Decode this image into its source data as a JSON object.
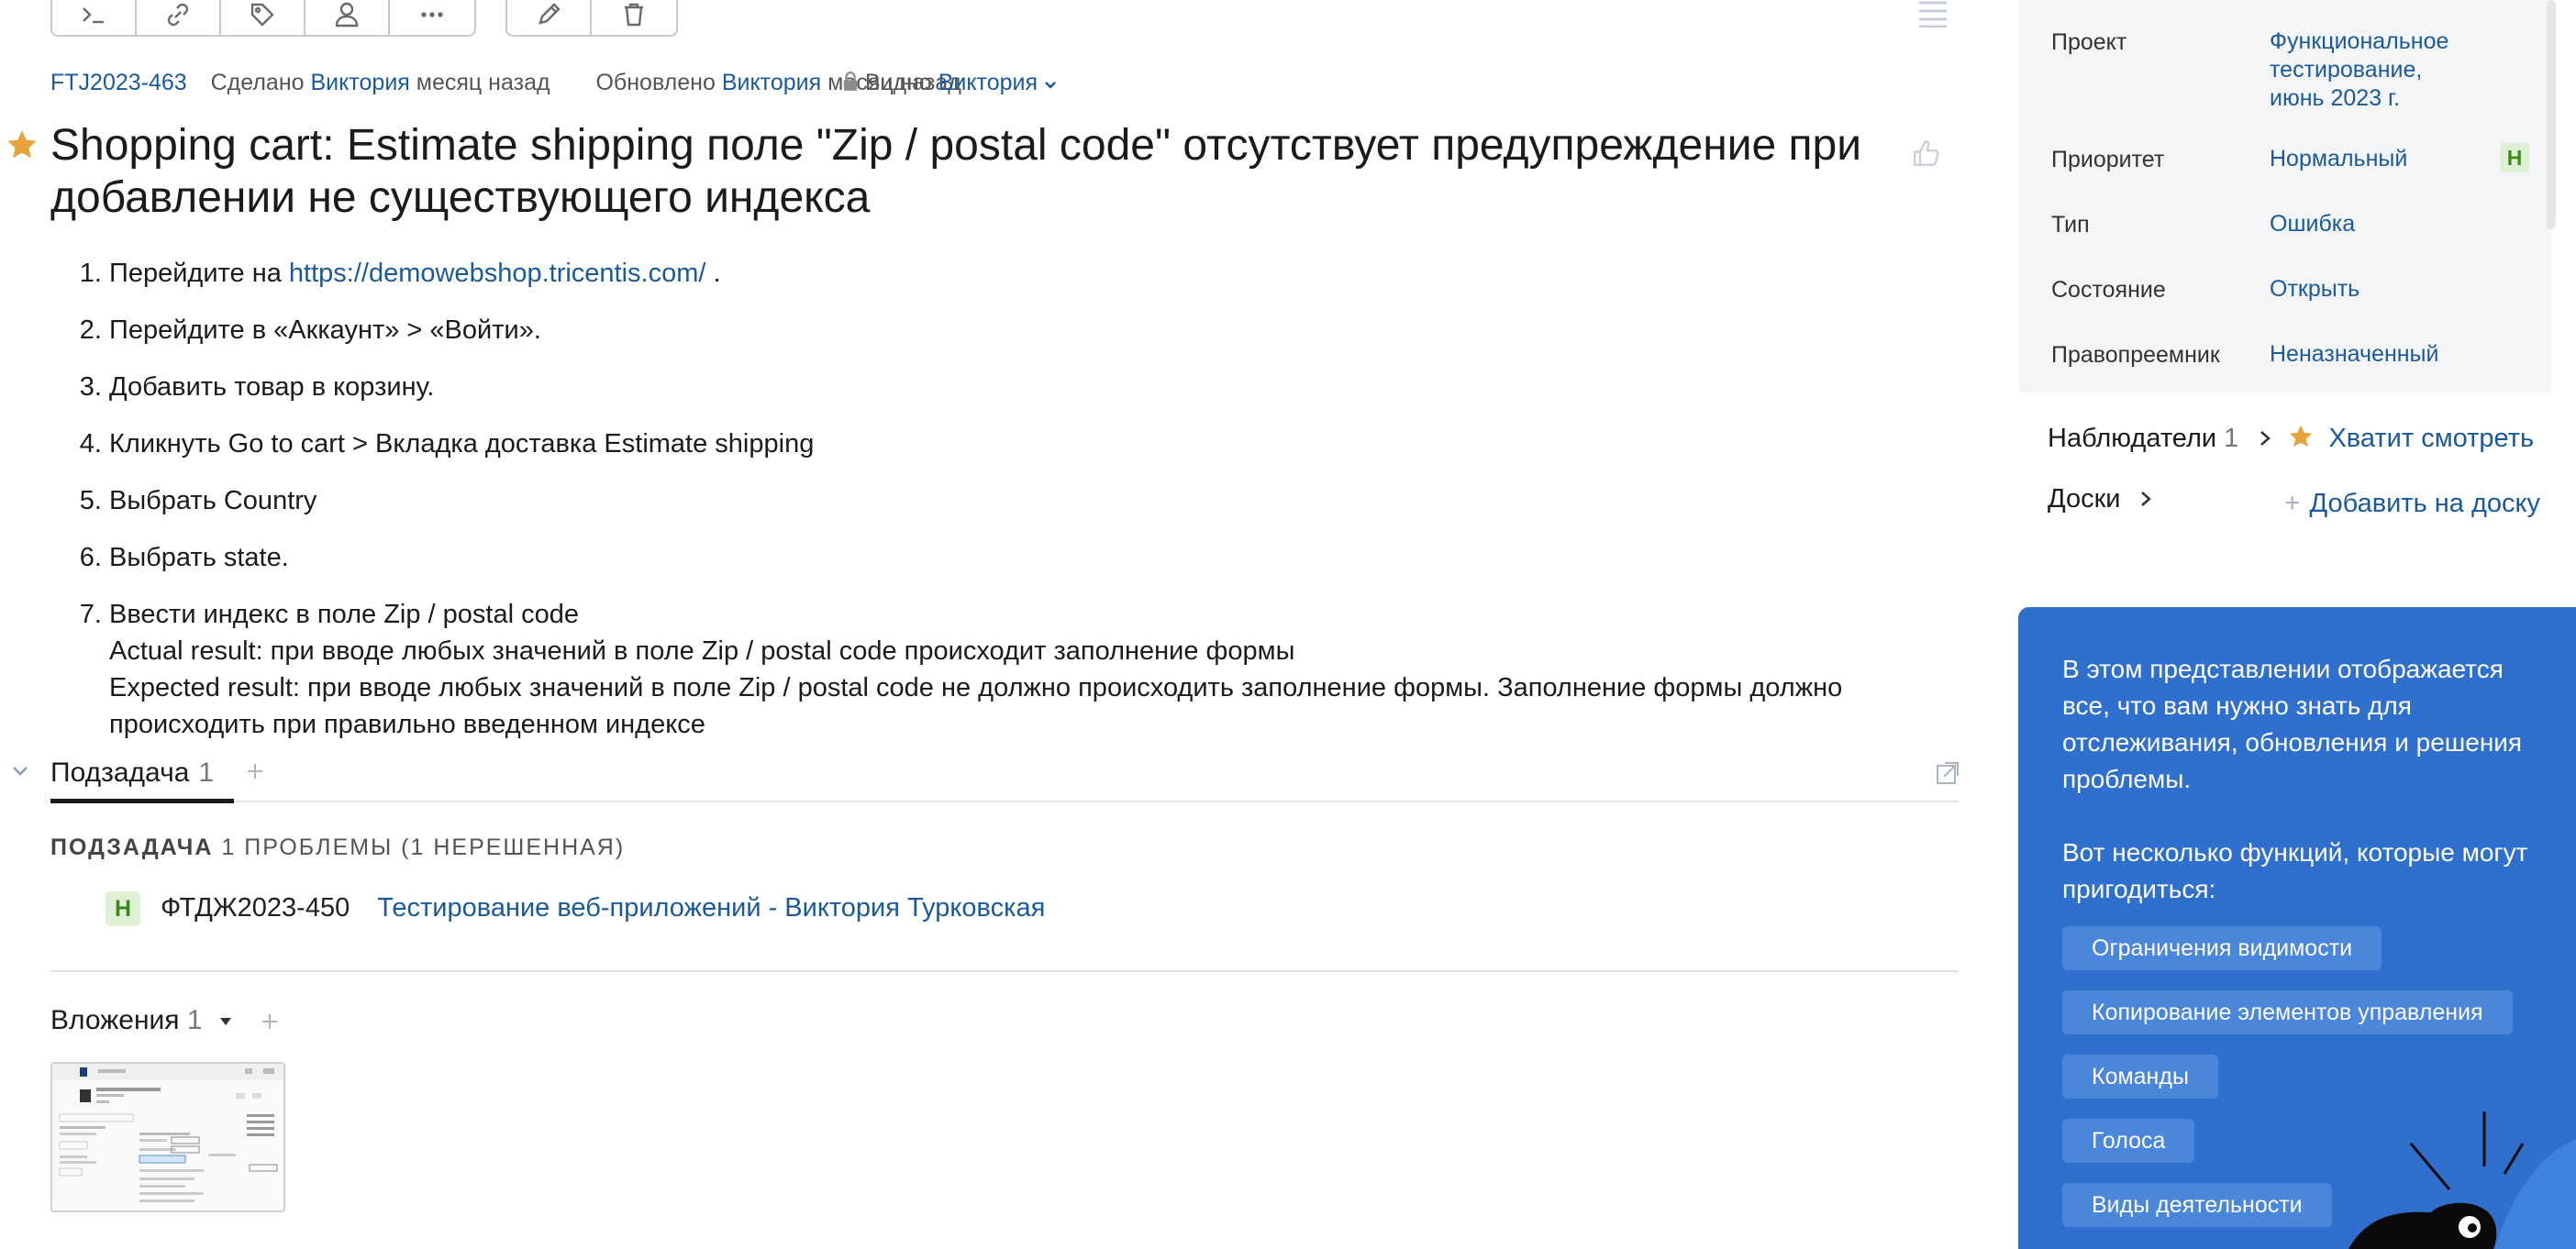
{
  "issue": {
    "key": "FTJ2023-463",
    "created_label": "Сделано",
    "creator": "Виктория",
    "created_when": "месяц назад",
    "updated_label": "Обновлено",
    "updater": "Виктория",
    "updated_when": "месяц назад",
    "visibility_label": "Видно",
    "visibility_value": "Виктория",
    "title": "Shopping cart: Estimate shipping поле \"Zip / postal code\" отсутствует предупреждение при добавлении не существующего индекса"
  },
  "steps": {
    "s1_prefix": "Перейдите на",
    "s1_link": "https://demowebshop.tricentis.com/",
    "s1_suffix": ".",
    "s2": "Перейдите в «Аккаунт» > «Войти».",
    "s3": "Добавить товар в корзину.",
    "s4": "Кликнуть Go to cart > Вкладка доставка Estimate shipping",
    "s5": "Выбрать Country",
    "s6": "Выбрать state.",
    "s7_line1": "Ввести индекс в поле Zip / postal code",
    "s7_line2": "Actual result: при вводе любых значений в поле Zip / postal code происходит заполнение формы",
    "s7_line3": "Expected result: при вводе любых значений в поле Zip / postal code не должно происходить заполнение формы. Заполнение формы должно происходить при правильно введенном индексе"
  },
  "subtasks": {
    "tab_label": "Подзадача",
    "tab_count": "1",
    "header_bold": "ПОДЗАДАЧА",
    "header_rest": "1 ПРОБЛЕМЫ (1 НЕРЕШЕННАЯ)",
    "row_badge": "Н",
    "row_key": "ФТДЖ2023-450",
    "row_title": "Тестирование веб-приложений - Виктория Турковская"
  },
  "attachments": {
    "label": "Вложения",
    "count": "1"
  },
  "properties": {
    "project_label": "Проект",
    "project_value_1": "Функциональное",
    "project_value_2": "тестирование,",
    "project_value_3": "июнь 2023 г.",
    "priority_label": "Приоритет",
    "priority_value": "Нормальный",
    "priority_badge": "Н",
    "type_label": "Тип",
    "type_value": "Ошибка",
    "state_label": "Состояние",
    "state_value": "Открыть",
    "assignee_label": "Правопреемник",
    "assignee_value": "Неназначенный"
  },
  "watchers": {
    "label": "Наблюдатели",
    "count": "1",
    "stop_watching": "Хватит смотреть"
  },
  "boards": {
    "label": "Доски",
    "add_label": "Добавить на доску"
  },
  "tips": {
    "intro": "В этом представлении отображается все, что вам нужно знать для отслеживания, обновления и решения проблемы.",
    "features_intro": "Вот несколько функций, которые могут пригодиться:",
    "pill1": "Ограничения видимости",
    "pill2": "Копирование элементов управления",
    "pill3": "Команды",
    "pill4": "Голоса",
    "pill5": "Виды деятельности"
  },
  "colors": {
    "link": "#1a5a9c",
    "star": "#e8a33d",
    "tips_bg": "#2f6fcd",
    "badge_bg": "#dff0d4",
    "badge_text": "#3c8a1c"
  }
}
